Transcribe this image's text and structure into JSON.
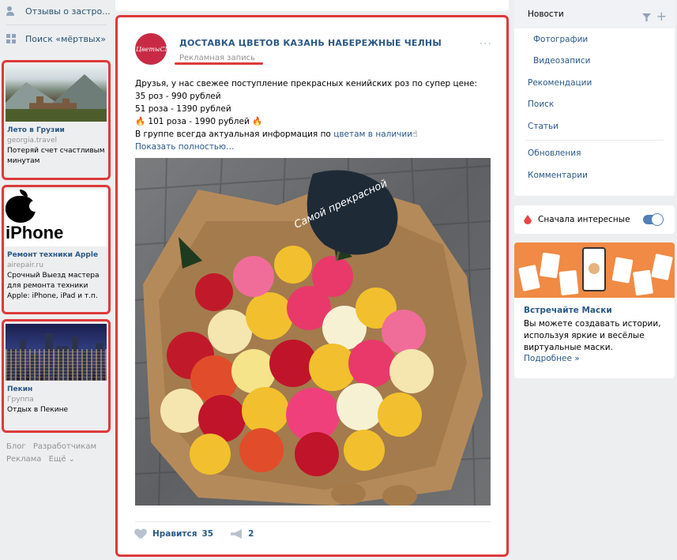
{
  "left_menu": {
    "items": [
      {
        "label": "Отзывы о застро...",
        "icon": "people-icon"
      },
      {
        "label": "Поиск «мёртвых»",
        "icon": "apps-grid-icon"
      }
    ]
  },
  "left_ads": [
    {
      "title": "Лето в Грузии",
      "domain": "georgia.travel",
      "text": "Потеряй счет счастливым минутам"
    },
    {
      "title": "Ремонт техники Apple",
      "domain": "airepair.ru",
      "text": "Срочный Выезд мастера для ремонта техники Apple: iPhone, iPad и т.п.",
      "image_text": "iPhone"
    },
    {
      "title": "Пекин",
      "domain": "Группа",
      "text": "Отдых в Пекине"
    }
  ],
  "left_footer": {
    "links": [
      "Блог",
      "Разработчикам",
      "Реклама",
      "Ещё ⌄"
    ]
  },
  "post": {
    "avatar_text": "#ЦветыСМ",
    "group_name": "ДОСТАВКА ЦВЕТОВ КАЗАНЬ НАБЕРЕЖНЫЕ ЧЕЛНЫ",
    "ad_label": "Рекламная запись",
    "more": "···",
    "lines": [
      "Друзья, у нас свежее поступление прекрасных кенийских роз по супер цене:",
      "35 роз - 990 рублей",
      "51 роза - 1390 рублей",
      "🔥 101 роза - 1990 рублей 🔥"
    ],
    "last_line_prefix": "В группе всегда актуальная информация по ",
    "last_line_link": "цветам в наличии",
    "last_line_suffix": "☝",
    "show_more": "Показать полностью…",
    "sign_text": "Самой прекрасной",
    "like_label": "Нравится",
    "like_count": "35",
    "share_count": "2"
  },
  "right_menu": {
    "active": "Новости",
    "items": [
      {
        "label": "Фотографии",
        "sub": true
      },
      {
        "label": "Видеозаписи",
        "sub": true
      },
      {
        "label": "Рекомендации",
        "sub": false
      },
      {
        "label": "Поиск",
        "sub": false
      },
      {
        "label": "Статьи",
        "sub": false
      }
    ],
    "items2": [
      {
        "label": "Обновления"
      },
      {
        "label": "Комментарии"
      }
    ]
  },
  "right_toggle": {
    "label": "Сначала интересные",
    "on": true
  },
  "right_promo": {
    "title": "Встречайте Маски",
    "text": "Вы можете создавать истории, используя яркие и весёлые виртуальные маски.",
    "more": "Подробнее »"
  },
  "colors": {
    "accent": "#de3a3a",
    "link": "#2a5885",
    "bg": "#edeef0",
    "brand": "#5181b8"
  }
}
